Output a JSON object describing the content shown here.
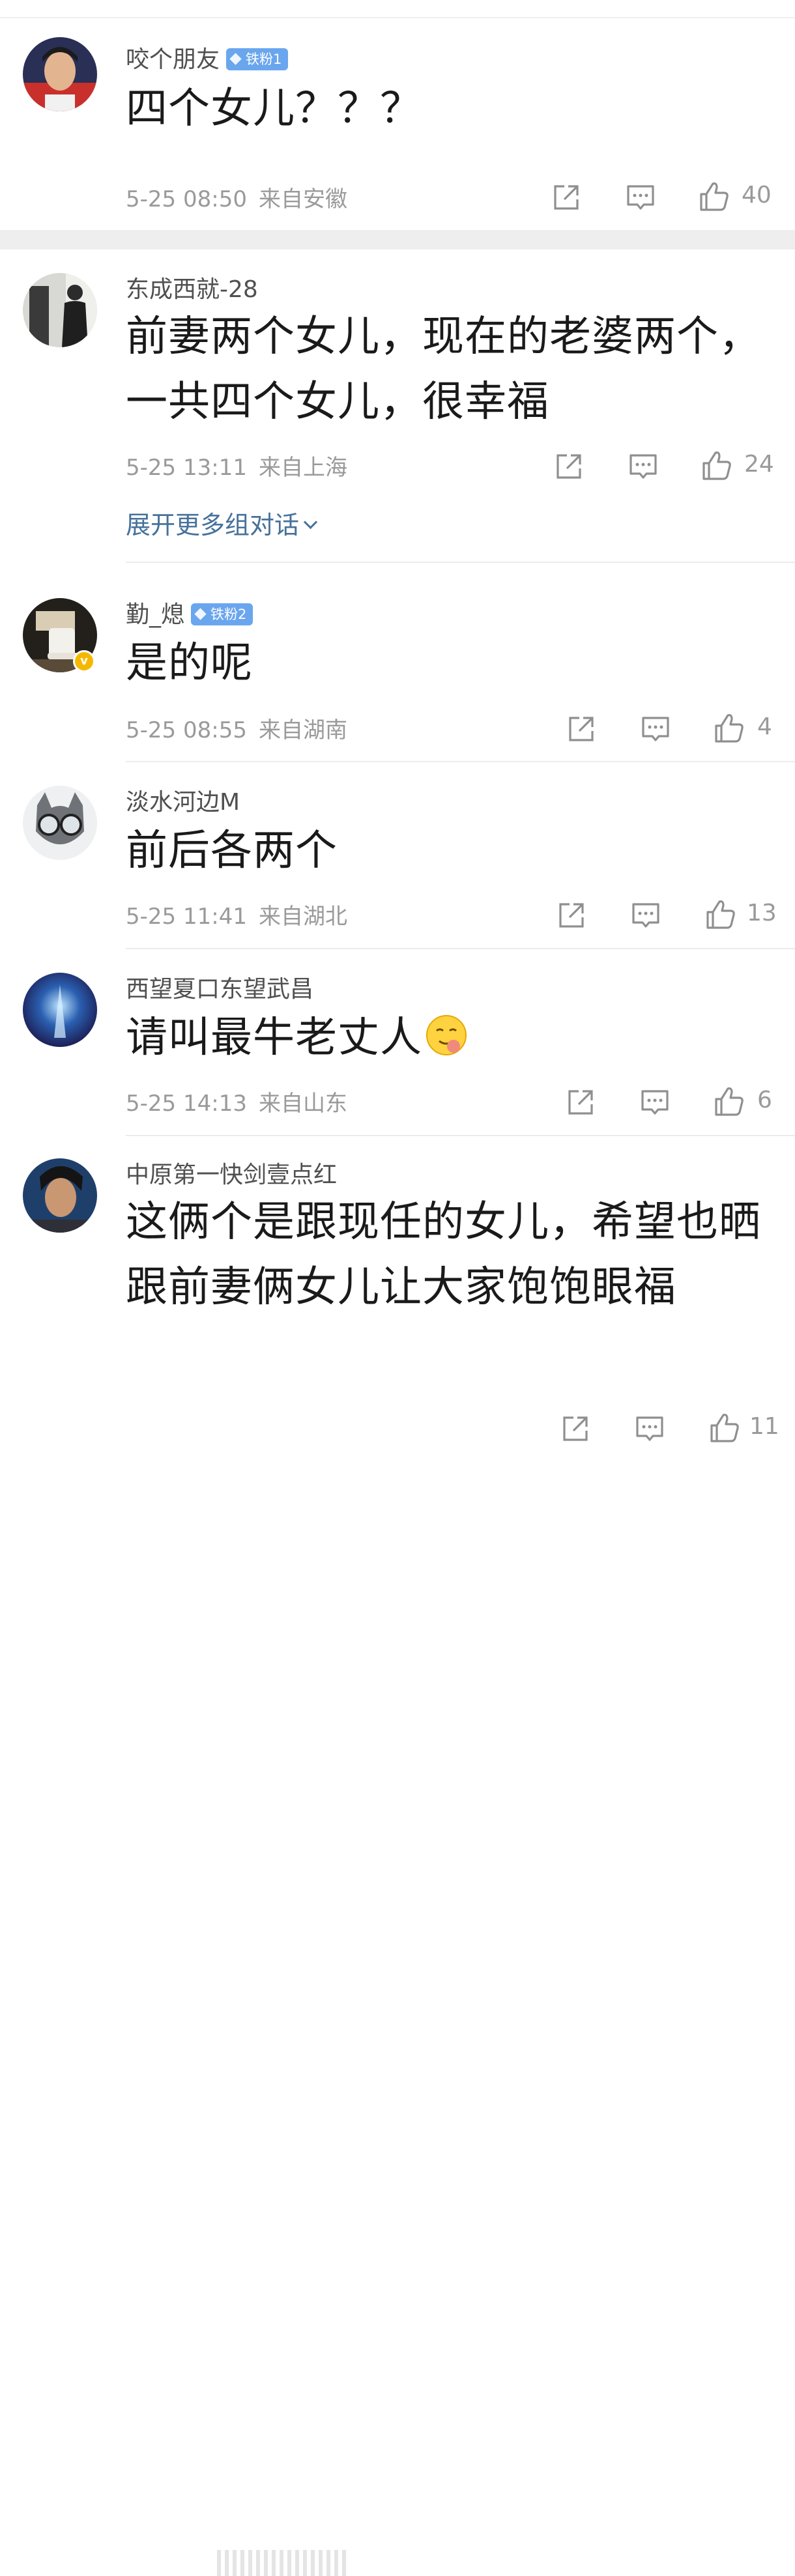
{
  "comments": [
    {
      "username": "咬个朋友",
      "fan_badge": "铁粉1",
      "text": "四个女儿？？？",
      "date": "5-25 08:50",
      "location": "来自安徽",
      "likes": "40"
    },
    {
      "username": "东成西就-28",
      "text": "前妻两个女儿，现在的老婆两个，一共四个女儿，很幸福",
      "date": "5-25 13:11",
      "location": "来自上海",
      "likes": "24",
      "expand_label": "展开更多组对话"
    },
    {
      "username": "勤_熄",
      "fan_badge": "铁粉2",
      "text": "是的呢",
      "date": "5-25 08:55",
      "location": "来自湖南",
      "likes": "4",
      "verified": true
    },
    {
      "username": "淡水河边M",
      "text": "前后各两个",
      "date": "5-25 11:41",
      "location": "来自湖北",
      "likes": "13"
    },
    {
      "username": "西望夏口东望武昌",
      "text": "请叫最牛老丈人",
      "emoji": "yummy-face-emoji",
      "date": "5-25 14:13",
      "location": "来自山东",
      "likes": "6"
    },
    {
      "username": "中原第一快剑壹点红",
      "text": "这俩个是跟现任的女儿，希望也晒跟前妻俩女儿让大家饱饱眼福",
      "likes": "11"
    }
  ],
  "icons": {
    "share": "share-icon",
    "comment": "comment-icon",
    "like": "thumbs-up-icon"
  },
  "colors": {
    "fan_badge": "#6aa6ee",
    "link": "#46719b",
    "meta": "#9a9a9a",
    "separator": "#eeeeee",
    "verified": "#f5b800"
  }
}
